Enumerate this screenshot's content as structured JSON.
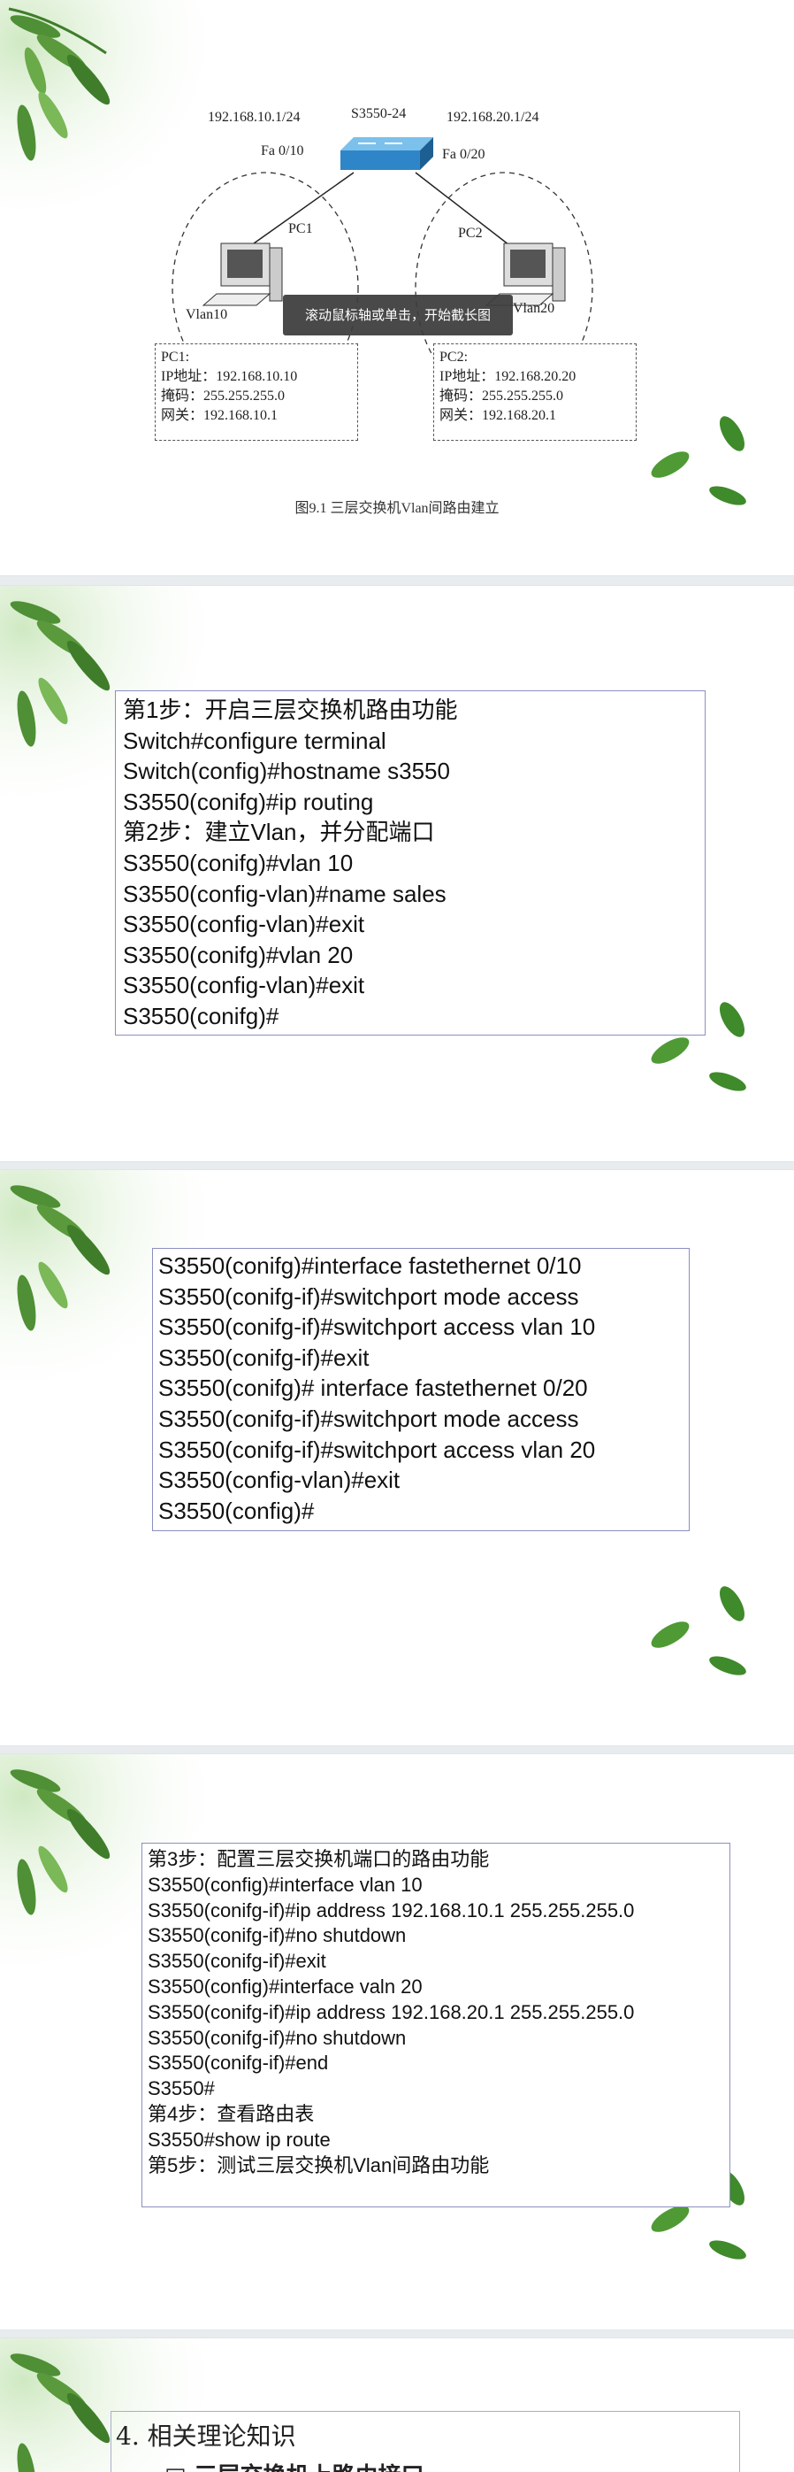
{
  "slide1": {
    "left_ip": "192.168.10.1/24",
    "switch_name": "S3550-24",
    "right_ip": "192.168.20.1/24",
    "left_port": "Fa 0/10",
    "right_port": "Fa 0/20",
    "pc1_label": "PC1",
    "pc2_label": "PC2",
    "vlan10_label": "Vlan10",
    "vlan20_label": "Vlan20",
    "tooltip": "滚动鼠标轴或单击，开始截长图",
    "pc1_info": [
      "PC1:",
      "IP地址：192.168.10.10",
      "掩码：255.255.255.0",
      "网关：192.168.10.1"
    ],
    "pc2_info": [
      "PC2:",
      "IP地址：192.168.20.20",
      "掩码：255.255.255.0",
      "网关：192.168.20.1"
    ],
    "caption": "图9.1   三层交换机Vlan间路由建立"
  },
  "slide2": {
    "lines": [
      "第1步：开启三层交换机路由功能",
      "Switch#configure terminal",
      "Switch(config)#hostname s3550",
      "S3550(conifg)#ip routing",
      "第2步：建立Vlan，并分配端口",
      "S3550(conifg)#vlan 10",
      "S3550(config-vlan)#name sales",
      "S3550(config-vlan)#exit",
      "S3550(conifg)#vlan 20",
      "S3550(config-vlan)#exit",
      "S3550(conifg)#"
    ]
  },
  "slide3": {
    "lines": [
      "S3550(conifg)#interface fastethernet 0/10",
      "S3550(conifg-if)#switchport mode access",
      "S3550(conifg-if)#switchport access vlan 10",
      "S3550(conifg-if)#exit",
      "S3550(conifg)# interface fastethernet 0/20",
      "S3550(conifg-if)#switchport mode access",
      "S3550(conifg-if)#switchport access vlan 20",
      "S3550(config-vlan)#exit",
      "S3550(config)#"
    ]
  },
  "slide4": {
    "lines": [
      "第3步：配置三层交换机端口的路由功能",
      "S3550(config)#interface vlan 10",
      "S3550(conifg-if)#ip address 192.168.10.1 255.255.255.0",
      "S3550(conifg-if)#no shutdown",
      "S3550(conifg-if)#exit",
      "S3550(config)#interface valn 20",
      "S3550(conifg-if)#ip address 192.168.20.1 255.255.255.0",
      "S3550(conifg-if)#no shutdown",
      "S3550(conifg-if)#end",
      "S3550#",
      "第4步：查看路由表",
      "S3550#show ip route",
      "第5步：测试三层交换机Vlan间路由功能"
    ]
  },
  "slide5": {
    "heading": "4. 相关理论知识",
    "sub": "□  三层交换机上路由接口"
  },
  "colors": {
    "box_border": "#8a8fc0",
    "switch_blue": "#2e86c8",
    "leaf_green": "#3f7d2b"
  }
}
